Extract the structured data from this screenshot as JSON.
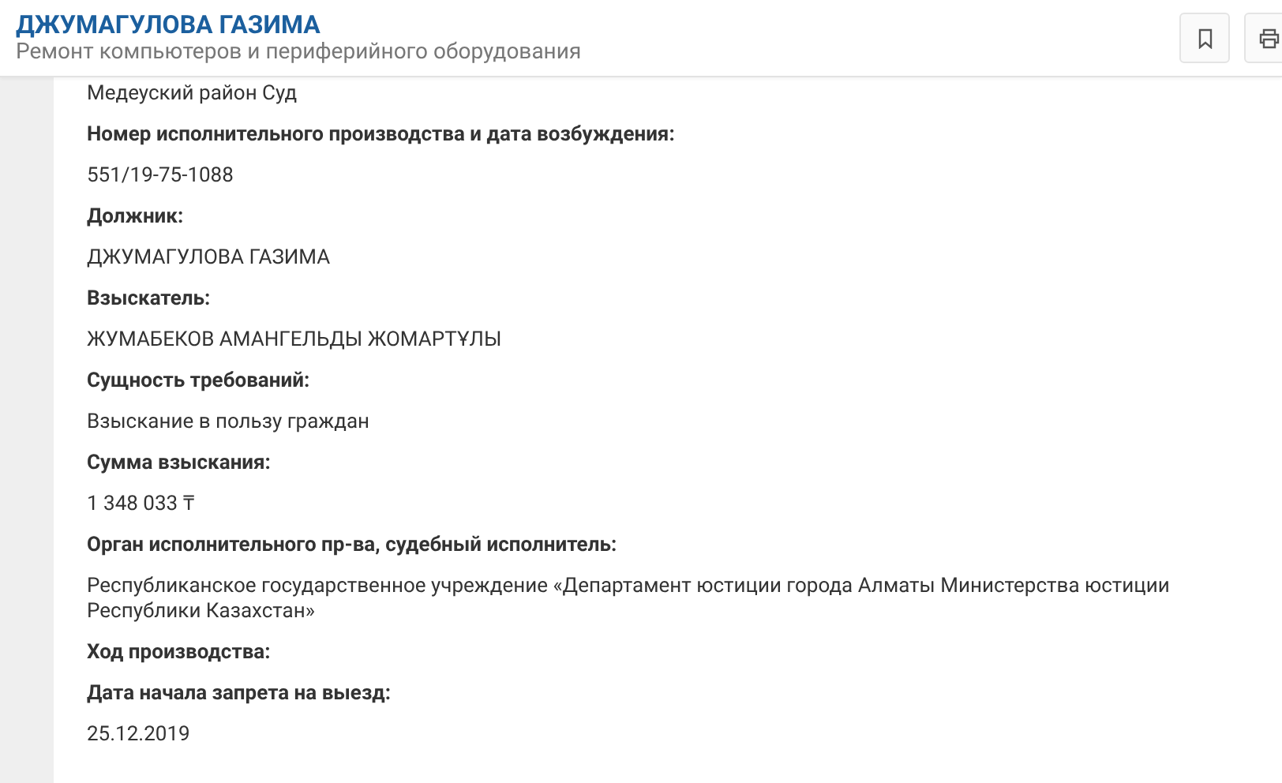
{
  "header": {
    "title": "ДЖУМАГУЛОВА ГАЗИМА",
    "subtitle": "Ремонт компьютеров и периферийного оборудования"
  },
  "content": {
    "cut_line": "Медеуский район Суд",
    "fields": [
      {
        "label": "Номер исполнительного производства и дата возбуждения:",
        "value": "551/19-75-1088"
      },
      {
        "label": "Должник:",
        "value": "ДЖУМАГУЛОВА ГАЗИМА"
      },
      {
        "label": "Взыскатель:",
        "value": "ЖУМАБЕКОВ АМАНГЕЛЬДЫ ЖОМАРТҰЛЫ"
      },
      {
        "label": "Сущность требований:",
        "value": "Взыскание в пользу граждан"
      },
      {
        "label": "Сумма взыскания:",
        "value": "1 348 033 ₸"
      },
      {
        "label": "Орган исполнительного пр-ва, судебный исполнитель:",
        "value": "Республиканское государственное учреждение «Департамент юстиции города Алматы Министерства юстиции Республики Казахстан»"
      },
      {
        "label": "Ход производства:"
      },
      {
        "label": "Дата начала запрета на выезд:",
        "value": "25.12.2019"
      }
    ]
  }
}
